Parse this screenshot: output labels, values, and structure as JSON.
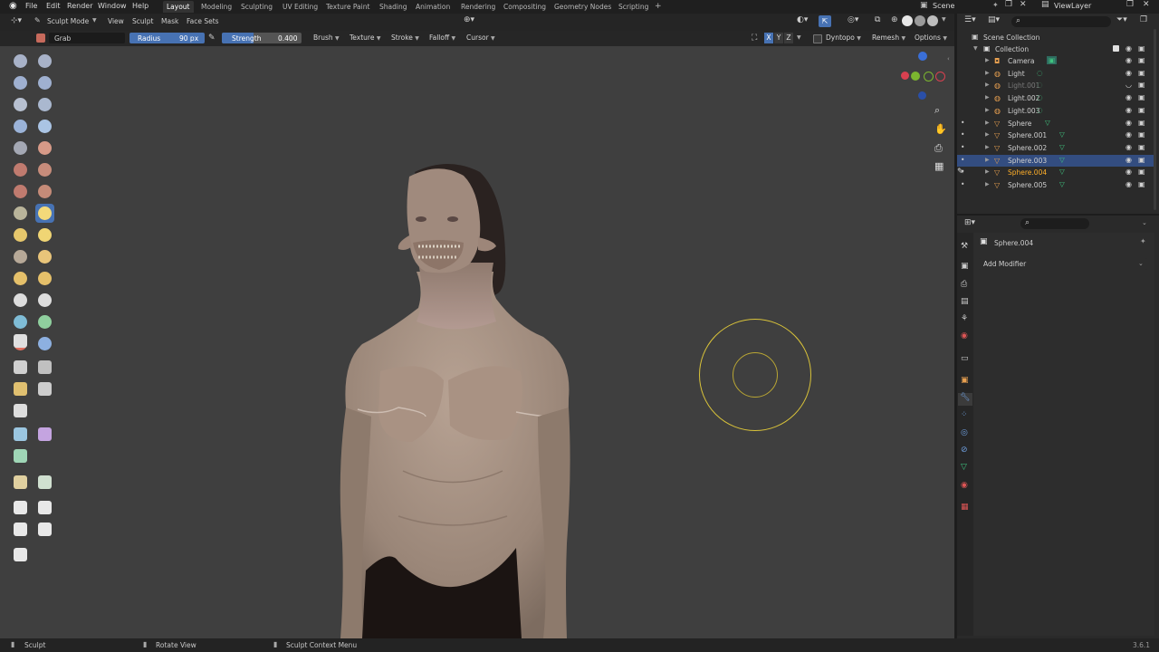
{
  "menu": {
    "items": [
      "File",
      "Edit",
      "Render",
      "Window",
      "Help"
    ],
    "workspaces": [
      "Layout",
      "Modeling",
      "Sculpting",
      "UV Editing",
      "Texture Paint",
      "Shading",
      "Animation",
      "Rendering",
      "Compositing",
      "Geometry Nodes",
      "Scripting"
    ],
    "add_tab": "+",
    "scene": "Scene",
    "view_layer": "ViewLayer"
  },
  "header": {
    "mode": "Sculpt Mode",
    "menus": [
      "View",
      "Sculpt",
      "Mask",
      "Face Sets"
    ]
  },
  "tool_settings": {
    "brush_name": "Grab",
    "radius_label": "Radius",
    "radius_value": "90 px",
    "strength_label": "Strength",
    "strength_value": "0.400",
    "dropdowns": [
      "Brush",
      "Texture",
      "Stroke",
      "Falloff",
      "Cursor"
    ],
    "axes": [
      "X",
      "Y",
      "Z"
    ],
    "dyntopo": "Dyntopo",
    "remesh": "Remesh",
    "options": "Options"
  },
  "outliner": {
    "root": "Scene Collection",
    "collection": "Collection",
    "items": [
      {
        "name": "Camera",
        "type": "camera",
        "state": "normal"
      },
      {
        "name": "Light",
        "type": "light",
        "state": "normal"
      },
      {
        "name": "Light.001",
        "type": "light",
        "state": "hidden"
      },
      {
        "name": "Light.002",
        "type": "light",
        "state": "normal"
      },
      {
        "name": "Light.003",
        "type": "light",
        "state": "normal"
      },
      {
        "name": "Sphere",
        "type": "mesh",
        "state": "normal"
      },
      {
        "name": "Sphere.001",
        "type": "mesh",
        "state": "normal"
      },
      {
        "name": "Sphere.002",
        "type": "mesh",
        "state": "normal"
      },
      {
        "name": "Sphere.003",
        "type": "mesh",
        "state": "selected"
      },
      {
        "name": "Sphere.004",
        "type": "mesh",
        "state": "active"
      },
      {
        "name": "Sphere.005",
        "type": "mesh",
        "state": "normal"
      }
    ]
  },
  "properties": {
    "object_name": "Sphere.004",
    "add_modifier": "Add Modifier"
  },
  "statusbar": {
    "left": "Sculpt",
    "middle": "Rotate View",
    "right": "Sculpt Context Menu",
    "version": "3.6.1"
  },
  "colors": {
    "accent_blue": "#4772b3",
    "selected_row": "#334d80",
    "active_orange": "#ffaf29",
    "brush_circle": "#d8c23a"
  }
}
